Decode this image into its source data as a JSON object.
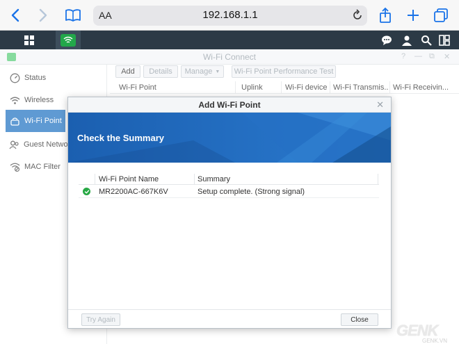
{
  "browser": {
    "aa_label": "AA",
    "url": "192.168.1.1"
  },
  "window": {
    "title": "Wi-Fi Connect",
    "controls": [
      "?",
      "—",
      "⧉",
      "✕"
    ]
  },
  "sidebar": {
    "items": [
      {
        "label": "Status",
        "icon": "gauge-icon"
      },
      {
        "label": "Wireless",
        "icon": "wifi-icon"
      },
      {
        "label": "Wi-Fi Point",
        "icon": "router-icon",
        "active": true
      },
      {
        "label": "Guest Networ",
        "icon": "guest-icon"
      },
      {
        "label": "MAC Filter",
        "icon": "wifi-filter-icon"
      }
    ]
  },
  "toolbar": {
    "add": "Add",
    "details": "Details",
    "manage": "Manage",
    "perf_test": "Wi-Fi Point Performance Test"
  },
  "grid": {
    "columns": [
      "Wi-Fi Point",
      "Uplink",
      "Wi-Fi device",
      "Wi-Fi Transmis...",
      "Wi-Fi Receivin..."
    ]
  },
  "dialog": {
    "title": "Add Wi-Fi Point",
    "banner": "Check the Summary",
    "table": {
      "headers": [
        "Wi-Fi Point Name",
        "Summary"
      ],
      "rows": [
        {
          "status": "ok",
          "name": "MR2200AC-667K6V",
          "summary": "Setup complete. (Strong signal)"
        }
      ]
    },
    "try_again": "Try Again",
    "close": "Close"
  },
  "watermark": {
    "main": "GENK",
    "sub": "GENK.VN"
  },
  "colors": {
    "accent": "#2a78c4",
    "taskbar": "#2c3a46",
    "success": "#27a844",
    "banner": "#1a5aa8"
  }
}
